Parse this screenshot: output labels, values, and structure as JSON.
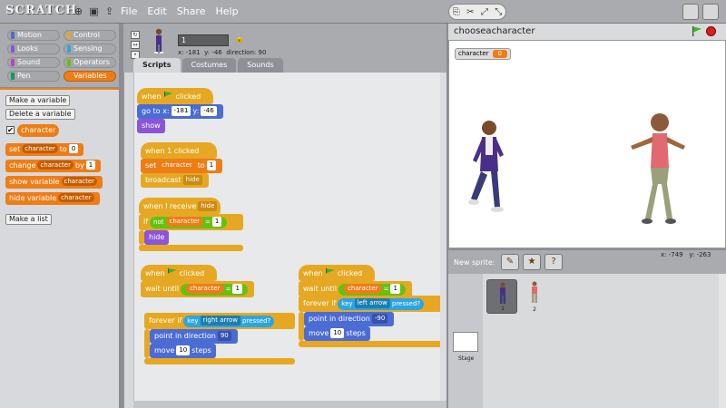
{
  "app": {
    "logo": "SCRATCH"
  },
  "menu": [
    "File",
    "Edit",
    "Share",
    "Help"
  ],
  "categories": [
    {
      "label": "Motion",
      "color": "#4a6cd4"
    },
    {
      "label": "Control",
      "color": "#e6a822"
    },
    {
      "label": "Looks",
      "color": "#8a55d7"
    },
    {
      "label": "Sensing",
      "color": "#2ca5e2"
    },
    {
      "label": "Sound",
      "color": "#bb42c3"
    },
    {
      "label": "Operators",
      "color": "#62c213"
    },
    {
      "label": "Pen",
      "color": "#0e9a6c"
    },
    {
      "label": "Variables",
      "color": "#ee7d16"
    }
  ],
  "palette": {
    "make_variable": "Make a variable",
    "delete_variable": "Delete a variable",
    "variable_name": "character",
    "set_label": "set",
    "set_to": "to",
    "set_value": "0",
    "change_label": "change",
    "change_by": "by",
    "change_value": "1",
    "show_variable": "show variable",
    "hide_variable": "hide variable",
    "make_list": "Make a list"
  },
  "sprite": {
    "name": "1",
    "x_label": "x:",
    "x": "-181",
    "y_label": "y:",
    "y": "-46",
    "direction_label": "direction:",
    "direction": "90"
  },
  "tabs": [
    "Scripts",
    "Costumes",
    "Sounds"
  ],
  "scripts": {
    "s1": {
      "when": "when",
      "clicked": "clicked",
      "goto": "go to x:",
      "x": "-181",
      "y_label": "y:",
      "y": "-46",
      "show": "show"
    },
    "s2": {
      "hat": "when 1 clicked",
      "set": "set",
      "var": "character",
      "to": "to",
      "value": "1",
      "broadcast": "broadcast",
      "msg": "hide"
    },
    "s3": {
      "hat": "when I receive",
      "msg": "hide",
      "if": "if",
      "not": "not",
      "var": "character",
      "eq": "=",
      "value": "1",
      "hide": "hide"
    },
    "s4": {
      "when": "when",
      "clicked": "clicked",
      "wait_until": "wait until",
      "var": "character",
      "eq": "=",
      "value": "1",
      "forever_if": "forever if",
      "key": "key",
      "key_name": "right arrow",
      "pressed": "pressed?",
      "point": "point in direction",
      "direction": "90",
      "move": "move",
      "steps_value": "10",
      "steps": "steps"
    },
    "s5": {
      "when": "when",
      "clicked": "clicked",
      "wait_until": "wait until",
      "var": "character",
      "eq": "=",
      "value": "1",
      "forever_if": "forever if",
      "key": "key",
      "key_name": "left arrow",
      "pressed": "pressed?",
      "point": "point in direction",
      "direction": "-90",
      "move": "move",
      "steps_value": "10",
      "steps": "steps"
    }
  },
  "stage": {
    "title": "chooseacharacter",
    "watcher_label": "character",
    "watcher_value": "0"
  },
  "sprite_bar": {
    "new_sprite": "New sprite:",
    "mouse_x_label": "x:",
    "mouse_x": "-749",
    "mouse_y_label": "y:",
    "mouse_y": "-263"
  },
  "library": {
    "stage_label": "Stage",
    "sprites": [
      {
        "num": "1"
      },
      {
        "num": "2"
      }
    ]
  }
}
